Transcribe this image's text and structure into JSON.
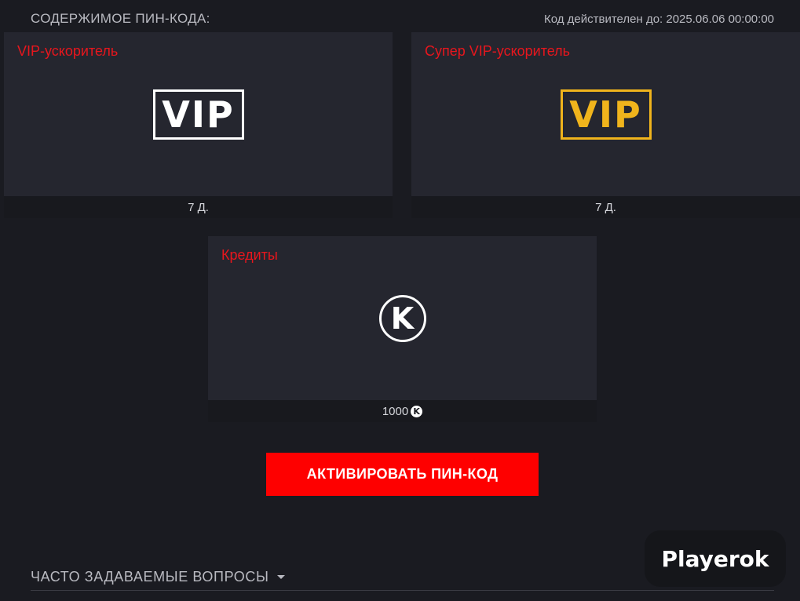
{
  "header": {
    "title": "СОДЕРЖИМОЕ ПИН-КОДА:",
    "valid_until": "Код действителен до: 2025.06.06 00:00:00"
  },
  "cards": [
    {
      "title": "VIP-ускоритель",
      "icon_text": "VIP",
      "icon": "vip-white-icon",
      "footer": "7 Д."
    },
    {
      "title": "Супер VIP-ускоритель",
      "icon_text": "VIP",
      "icon": "vip-gold-icon",
      "footer": "7 Д."
    },
    {
      "title": "Кредиты",
      "icon_text": "K",
      "icon": "credits-icon",
      "footer_value": "1000",
      "footer_icon_text": "K",
      "footer_icon": "credits-small-icon"
    }
  ],
  "actions": {
    "activate_label": "АКТИВИРОВАТЬ ПИН-КОД"
  },
  "faq": {
    "label": "ЧАСТО ЗАДАВАЕМЫЕ ВОПРОСЫ",
    "icon": "caret-down-icon"
  },
  "brand": {
    "name": "Playerok"
  },
  "colors": {
    "background": "#1a1b21",
    "card": "#25262f",
    "footer": "#18191e",
    "accent_red": "#fe0000",
    "title_red": "#e8161d",
    "gold": "#f0b41c"
  }
}
